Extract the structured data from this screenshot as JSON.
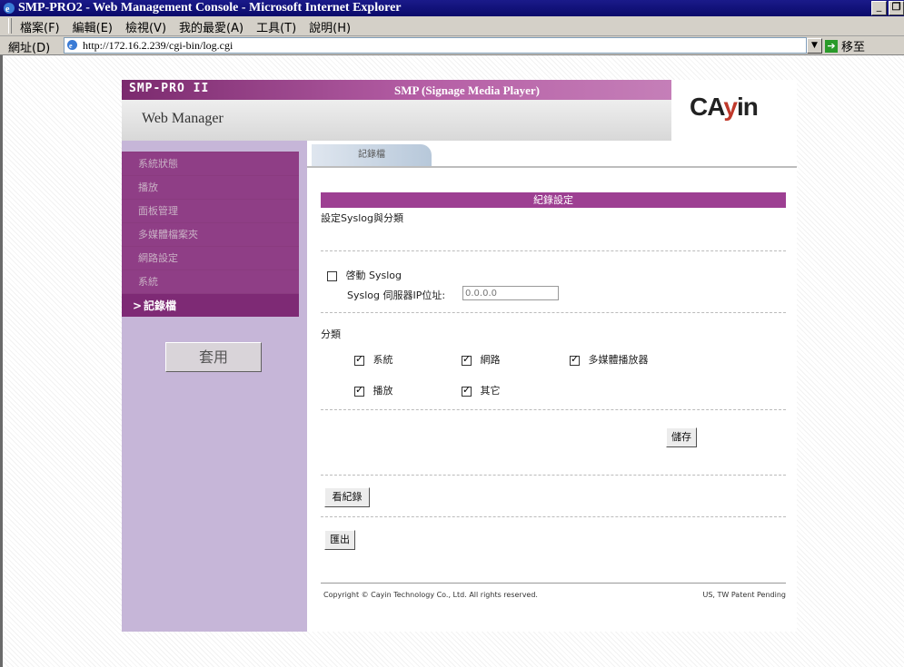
{
  "window": {
    "title": "SMP-PRO2 - Web Management Console - Microsoft Internet Explorer"
  },
  "menu": [
    "檔案(F)",
    "編輯(E)",
    "檢視(V)",
    "我的最愛(A)",
    "工具(T)",
    "說明(H)"
  ],
  "address": {
    "label": "網址(D)",
    "url": "http://172.16.2.239/cgi-bin/log.cgi",
    "go_label": "移至"
  },
  "header": {
    "product_line": "SMP-PRO II",
    "product_name": "SMP (Signage Media Player)",
    "web_manager": "Web Manager",
    "brand": "CAYIN"
  },
  "sidebar": {
    "items": [
      {
        "label": "系統狀態"
      },
      {
        "label": "播放"
      },
      {
        "label": "面板管理"
      },
      {
        "label": "多媒體檔案夾"
      },
      {
        "label": "網路設定"
      },
      {
        "label": "系統"
      },
      {
        "label": "記錄檔"
      }
    ],
    "apply_label": "套用"
  },
  "tab": {
    "label": "記錄檔"
  },
  "section": {
    "title": "紀錄設定",
    "subtitle": "設定Syslog與分類"
  },
  "syslog": {
    "enable_label": "啓動 Syslog",
    "enabled": false,
    "ip_label": "Syslog 伺服器IP位址:",
    "ip_value": "0.0.0.0"
  },
  "category": {
    "label": "分類",
    "items": [
      {
        "label": "系統",
        "checked": true
      },
      {
        "label": "網路",
        "checked": true
      },
      {
        "label": "多媒體播放器",
        "checked": true
      },
      {
        "label": "播放",
        "checked": true
      },
      {
        "label": "其它",
        "checked": true
      }
    ]
  },
  "buttons": {
    "save": "儲存",
    "view_log": "看紀錄",
    "export": "匯出"
  },
  "footer": {
    "copyright": "Copyright © Cayin Technology Co., Ltd. All rights reserved.",
    "patent": "US, TW Patent Pending"
  }
}
